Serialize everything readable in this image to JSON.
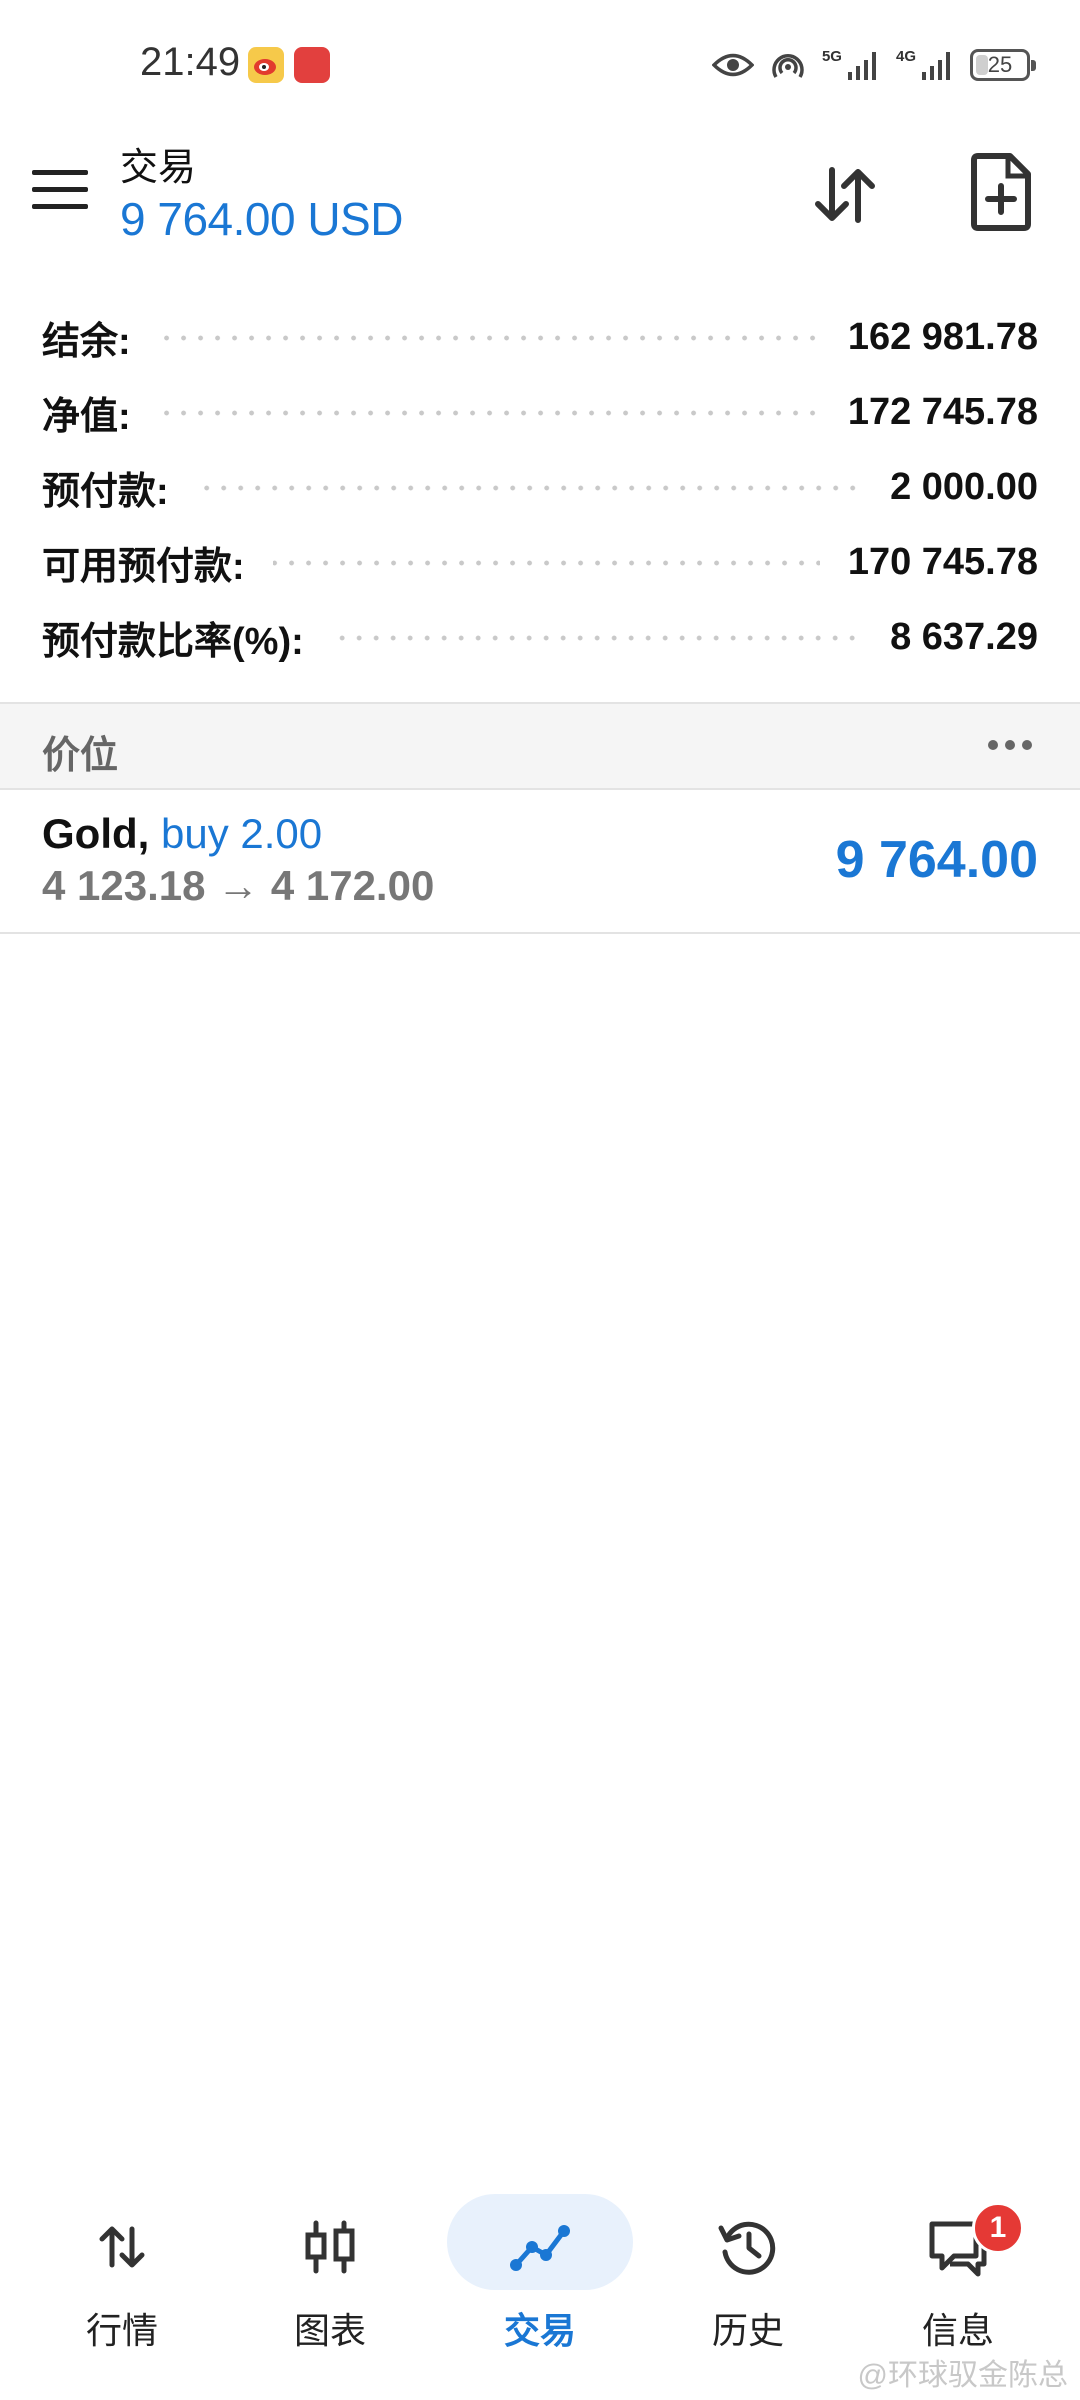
{
  "status_bar": {
    "time": "21:49",
    "net1": "5G",
    "net2": "4G",
    "battery": "25",
    "battery_level": 0.25
  },
  "header": {
    "title": "交易",
    "amount": "9 764.00 USD"
  },
  "summary": {
    "rows": [
      {
        "label": "结余:",
        "value": "162 981.78"
      },
      {
        "label": "净值:",
        "value": "172 745.78"
      },
      {
        "label": "预付款:",
        "value": "2 000.00"
      },
      {
        "label": "可用预付款:",
        "value": "170 745.78"
      },
      {
        "label": "预付款比率(%):",
        "value": "8 637.29"
      }
    ]
  },
  "section": {
    "title": "价位"
  },
  "position": {
    "symbol": "Gold,",
    "side": "buy 2.00",
    "prices": "4 123.18 → 4 172.00",
    "profit": "9 764.00"
  },
  "bottom_nav": {
    "items": [
      {
        "label": "行情",
        "icon": "quotes-icon"
      },
      {
        "label": "图表",
        "icon": "chart-icon"
      },
      {
        "label": "交易",
        "icon": "trade-icon",
        "active": true
      },
      {
        "label": "历史",
        "icon": "history-icon"
      },
      {
        "label": "信息",
        "icon": "messages-icon",
        "badge": "1"
      }
    ]
  },
  "watermark": "@环球驭金陈总",
  "colors": {
    "accent": "#1a77d4",
    "badge": "#e53935"
  }
}
